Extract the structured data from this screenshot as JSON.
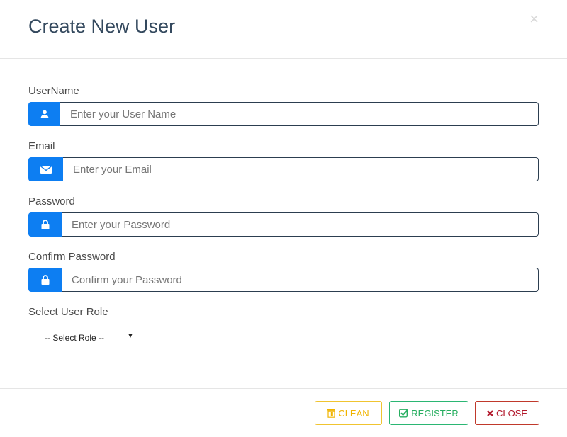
{
  "header": {
    "title": "Create New User",
    "close_symbol": "×"
  },
  "form": {
    "username": {
      "label": "UserName",
      "placeholder": "Enter your User Name",
      "value": "",
      "icon": "user-icon"
    },
    "email": {
      "label": "Email",
      "placeholder": "Enter your Email",
      "value": "",
      "icon": "envelope-icon"
    },
    "password": {
      "label": "Password",
      "placeholder": "Enter your Password",
      "value": "",
      "icon": "lock-icon"
    },
    "confirm_password": {
      "label": "Confirm Password",
      "placeholder": "Confirm your Password",
      "value": "",
      "icon": "lock-icon"
    },
    "role": {
      "label": "Select User Role",
      "selected": "-- Select Role --",
      "caret": "▼"
    }
  },
  "footer": {
    "clean_label": "CLEAN",
    "register_label": "REGISTER",
    "close_label": "CLOSE"
  },
  "colors": {
    "accent": "#0d7ef2",
    "title": "#34495e",
    "clean": "#f0b400",
    "register": "#27ae60",
    "close": "#b2182b"
  }
}
